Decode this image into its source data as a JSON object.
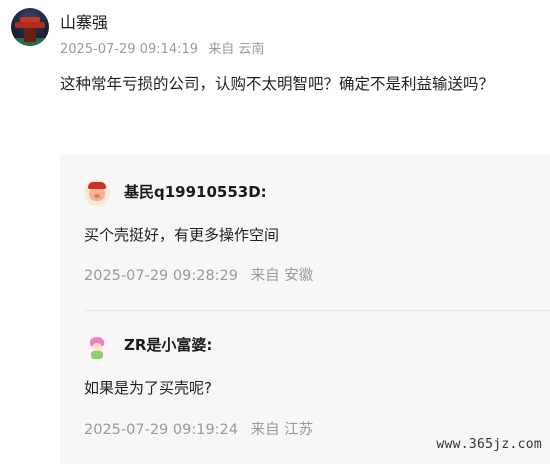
{
  "post": {
    "author": "山寨强",
    "timestamp": "2025-07-29 09:14:19",
    "location": "来自 云南",
    "text": "这种常年亏损的公司，认购不太明智吧？确定不是利益输送吗？"
  },
  "replies": [
    {
      "author": "基民q19910553D:",
      "text": "买个壳挺好，有更多操作空间",
      "timestamp": "2025-07-29 09:28:29",
      "location": "来自 安徽"
    },
    {
      "author": "ZR是小富婆:",
      "text": "如果是为了买壳呢?",
      "timestamp": "2025-07-29 09:19:24",
      "location": "来自 江苏"
    }
  ],
  "watermark": "www.365jz.com"
}
